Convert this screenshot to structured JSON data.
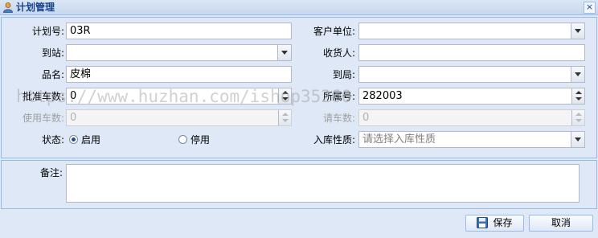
{
  "window": {
    "title": "计划管理",
    "close_label": "×"
  },
  "form": {
    "plan_no": {
      "label": "计划号:",
      "value": "03R"
    },
    "customer_unit": {
      "label": "客户单位:",
      "value": ""
    },
    "to_station": {
      "label": "到站:",
      "value": ""
    },
    "consignee": {
      "label": "收货人:",
      "value": ""
    },
    "product_name": {
      "label": "品名:",
      "value": "皮棉"
    },
    "to_bureau": {
      "label": "到局:",
      "value": ""
    },
    "approved_cars": {
      "label": "批准车数:",
      "value": "0"
    },
    "belonging_no": {
      "label": "所属号:",
      "value": "282003"
    },
    "used_cars": {
      "label": "使用车数:",
      "value": "0"
    },
    "requested_cars": {
      "label": "请车数:",
      "value": "0"
    },
    "status": {
      "label": "状态:",
      "options": [
        {
          "label": "启用",
          "checked": true
        },
        {
          "label": "停用",
          "checked": false
        }
      ]
    },
    "storage_type": {
      "label": "入库性质:",
      "placeholder": "请选择入库性质"
    },
    "remark": {
      "label": "备注:",
      "value": ""
    }
  },
  "buttons": {
    "save": "保存",
    "cancel": "取消"
  },
  "watermark": "https://www.huzhan.com/ishop35260",
  "colors": {
    "title_text": "#15428b",
    "panel_bg": "#dfe8f6",
    "border": "#99bbe8"
  }
}
